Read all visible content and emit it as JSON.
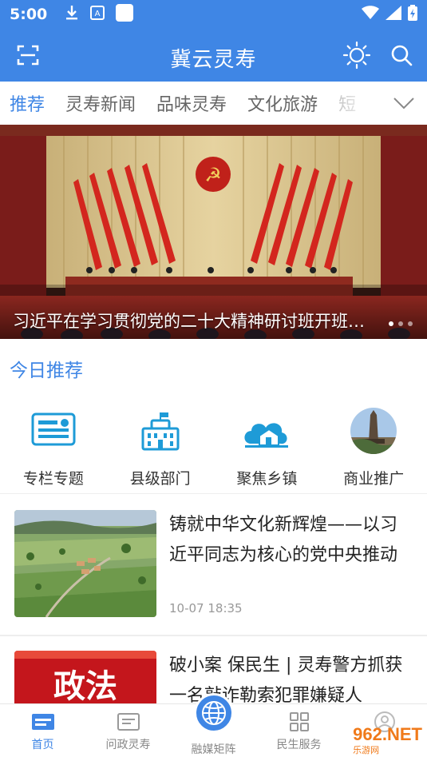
{
  "status_bar": {
    "time": "5:00",
    "icons_left": [
      "download-icon",
      "app-notification-icon",
      "blank-square-icon"
    ],
    "icons_right": [
      "wifi-icon",
      "signal-icon",
      "battery-charging-icon"
    ]
  },
  "header": {
    "title": "冀云灵寿",
    "left_icon": "scan-icon",
    "right_icons": [
      "brightness-icon",
      "search-icon"
    ],
    "color": "#3f86e5"
  },
  "tabs": [
    {
      "label": "推荐",
      "active": true
    },
    {
      "label": "灵寿新闻",
      "active": false
    },
    {
      "label": "品味灵寿",
      "active": false
    },
    {
      "label": "文化旅游",
      "active": false
    },
    {
      "label": "短",
      "active": false
    }
  ],
  "tabs_more_icon": "chevron-down-icon",
  "banner": {
    "caption": "习近平在学习贯彻党的二十大精神研讨班开班式上发表重要讲话",
    "slide_count": 3,
    "active_slide": 1
  },
  "today": {
    "title": "今日推荐"
  },
  "categories": [
    {
      "label": "专栏专题",
      "icon": "column-topic-icon"
    },
    {
      "label": "县级部门",
      "icon": "government-building-icon"
    },
    {
      "label": "聚焦乡镇",
      "icon": "village-house-icon"
    },
    {
      "label": "商业推广",
      "icon": "monument-photo-icon"
    }
  ],
  "news": [
    {
      "title": "铸就中华文化新辉煌——以习近平同志为核心的党中央推动文化繁荣发展",
      "time": "10-07 18:35",
      "thumb_label": ""
    },
    {
      "title": "破小案 保民生 | 灵寿警方抓获一名敲诈勒索犯罪嫌疑人",
      "time": "",
      "thumb_label": "政法"
    }
  ],
  "bottom_nav": [
    {
      "label": "首页",
      "icon": "home-icon",
      "active": true
    },
    {
      "label": "问政灵寿",
      "icon": "inquiry-icon",
      "active": false
    },
    {
      "label": "融媒矩阵",
      "icon": "globe-icon",
      "active": false
    },
    {
      "label": "民生服务",
      "icon": "services-grid-icon",
      "active": false
    },
    {
      "label": "",
      "icon": "profile-icon",
      "active": false
    }
  ],
  "watermark": {
    "text": "962.NET",
    "sub": "乐游网"
  }
}
